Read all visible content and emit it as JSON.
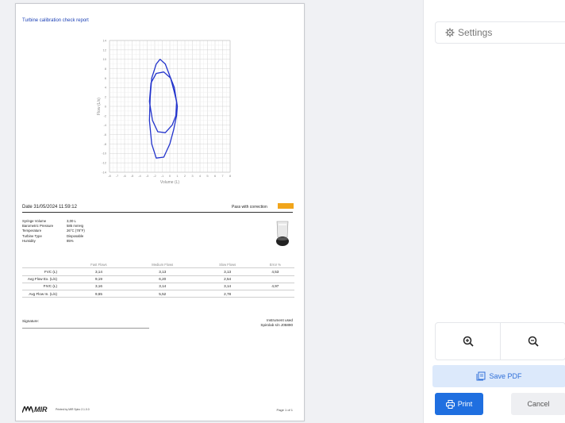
{
  "report": {
    "title": "Turbine calibration check report",
    "date": "Date 31/05/2024 11:59:12",
    "result": "Pass with correction",
    "result_color": "#f1a51b",
    "info": [
      {
        "label": "Syringe Volume",
        "value": "3,00 L"
      },
      {
        "label": "Barometric Pressure",
        "value": "585 mmHg"
      },
      {
        "label": "Temperature",
        "value": "26°C (78°F)"
      },
      {
        "label": "Turbine Type",
        "value": "Disposable"
      },
      {
        "label": "Humidity",
        "value": "85%"
      }
    ],
    "table": {
      "headers": [
        "",
        "Fast Flows",
        "Medium Flows",
        "Slow Flows",
        "Error %"
      ],
      "rows": [
        [
          "FVC (L)",
          "3,14",
          "3,13",
          "3,13",
          "4,53"
        ],
        [
          "Avg Flow Ex. (L/s)",
          "9,19",
          "6,20",
          "2,54",
          ""
        ],
        [
          "FIVC (L)",
          "3,16",
          "3,14",
          "3,14",
          "4,97"
        ],
        [
          "Avg Flow In. (L/s)",
          "9,65",
          "5,52",
          "2,78",
          ""
        ]
      ]
    },
    "signature_label": "Signature:",
    "instrument_line1": "Instrument used",
    "instrument_line2": "Spirolab s/n J05890",
    "logo_text": "MIR",
    "printed_by": "Printed by MIR Spiro 2.1.0.0",
    "page_label": "Page 1 of 1"
  },
  "chart_data": {
    "type": "line",
    "xlabel": "Volume (L)",
    "ylabel": "Flow (L/s)",
    "xlim": [
      -8,
      8
    ],
    "ylim": [
      -14,
      14
    ],
    "xticks": [
      -8,
      -7,
      -6,
      -5,
      -4,
      -3,
      -2,
      -1,
      0,
      1,
      2,
      3,
      4,
      5,
      6,
      7,
      8
    ],
    "yticks": [
      14,
      12,
      10,
      8,
      6,
      4,
      2,
      0,
      -2,
      -4,
      -6,
      -8,
      -10,
      -12,
      -14
    ],
    "grid": true,
    "line_color": "#2233cc",
    "series": [
      {
        "x": [
          -2.6,
          -2.4,
          -1.8,
          -1.3,
          -0.6,
          0.1,
          0.6,
          0.9,
          1.0,
          0.9,
          0.5,
          0.0,
          -0.8,
          -1.8,
          -2.4,
          -2.7,
          -2.6
        ],
        "y": [
          2,
          6,
          9,
          10,
          9,
          6,
          3,
          1,
          0,
          -2,
          -5,
          -8,
          -10.8,
          -11,
          -8,
          -3,
          2
        ]
      },
      {
        "x": [
          -2.7,
          -2.5,
          -1.8,
          -0.8,
          0.1,
          0.6,
          0.9,
          0.8,
          0.3,
          -0.6,
          -1.6,
          -2.3,
          -2.7
        ],
        "y": [
          1,
          5,
          7,
          7.3,
          6,
          4,
          1,
          -2,
          -4,
          -5.6,
          -5.4,
          -3,
          1
        ]
      }
    ]
  },
  "panel": {
    "settings_label": "Settings",
    "save_pdf_label": "Save PDF",
    "print_label": "Print",
    "cancel_label": "Cancel"
  }
}
